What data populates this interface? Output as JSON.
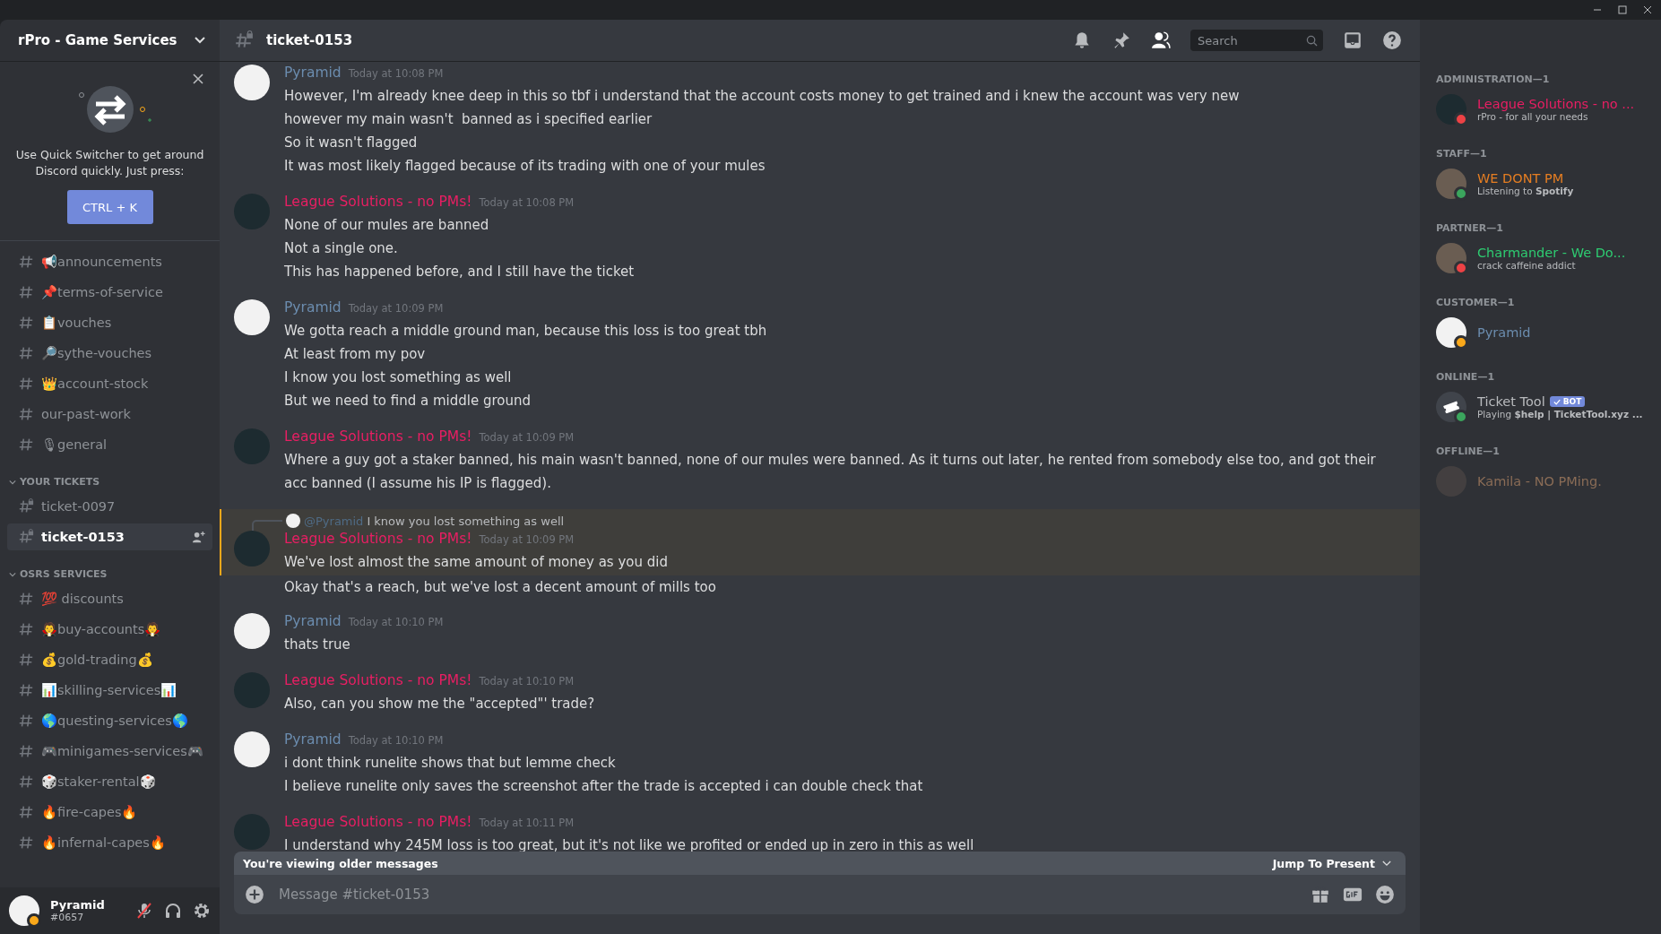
{
  "server": {
    "name": "rPro - Game Services"
  },
  "quick_switcher": {
    "text": "Use Quick Switcher to get around Discord quickly. Just press:",
    "button": "CTRL + K"
  },
  "channels": [
    {
      "name": "📢announcements",
      "kind": "text",
      "selected": false
    },
    {
      "name": "📌terms-of-service",
      "kind": "text",
      "selected": false
    },
    {
      "name": "📋vouches",
      "kind": "text",
      "selected": false
    },
    {
      "name": "🔎sythe-vouches",
      "kind": "text",
      "selected": false
    },
    {
      "name": "👑account-stock",
      "kind": "text",
      "selected": false
    },
    {
      "name": "our-past-work",
      "kind": "text",
      "selected": false
    },
    {
      "name": "🎙general",
      "kind": "text",
      "selected": false
    }
  ],
  "categories": [
    {
      "name": "YOUR TICKETS",
      "expanded": true,
      "channels": [
        {
          "name": "ticket-0097",
          "kind": "locked",
          "selected": false
        },
        {
          "name": "ticket-0153",
          "kind": "locked",
          "selected": true
        }
      ]
    },
    {
      "name": "OSRS SERVICES",
      "expanded": true,
      "channels": [
        {
          "name": "💯 discounts",
          "kind": "text",
          "selected": false
        },
        {
          "name": "🧛buy-accounts🧛",
          "kind": "text",
          "selected": false
        },
        {
          "name": "💰gold-trading💰",
          "kind": "text",
          "selected": false
        },
        {
          "name": "📊skilling-services📊",
          "kind": "text",
          "selected": false
        },
        {
          "name": "🌎questing-services🌎",
          "kind": "text",
          "selected": false
        },
        {
          "name": "🎮minigames-services🎮",
          "kind": "text",
          "selected": false
        },
        {
          "name": "🎲staker-rental🎲",
          "kind": "text",
          "selected": false
        },
        {
          "name": "🔥fire-capes🔥",
          "kind": "text",
          "selected": false
        },
        {
          "name": "🔥infernal-capes🔥",
          "kind": "text",
          "selected": false
        }
      ]
    }
  ],
  "user_panel": {
    "name": "Pyramid",
    "tag": "#0657",
    "idle": true
  },
  "header": {
    "channel": "ticket-0153",
    "search_placeholder": "Search"
  },
  "messages": [
    {
      "author": "Pyramid",
      "color": "#6b8cae",
      "kind": "pyramid",
      "time": "Today at 10:08 PM",
      "highlighted": false,
      "lines": [
        "However, I'm already knee deep in this so tbf i understand that the account costs money to get trained and i knew the account was very new",
        "however my main wasn't  banned as i specified earlier",
        "So it wasn't flagged",
        "It was most likely flagged because of its trading with one of your mules"
      ]
    },
    {
      "author": "League Solutions - no PMs!",
      "color": "#e91e63",
      "kind": "rpro",
      "time": "Today at 10:08 PM",
      "highlighted": false,
      "lines": [
        "None of our mules are banned",
        "Not a single one.",
        "This has happened before, and I still have the ticket"
      ]
    },
    {
      "author": "Pyramid",
      "color": "#6b8cae",
      "kind": "pyramid",
      "time": "Today at 10:09 PM",
      "highlighted": false,
      "lines": [
        "We gotta reach a middle ground man, because this loss is too great tbh",
        "At least from my pov",
        "I know you lost something as well",
        "But we need to find a middle ground"
      ]
    },
    {
      "author": "League Solutions - no PMs!",
      "color": "#e91e63",
      "kind": "rpro",
      "time": "Today at 10:09 PM",
      "highlighted": false,
      "lines": [
        "Where a guy got a staker banned, his main wasn't banned, none of our mules were banned. As it turns out later, he rented from somebody else too, and got their acc banned (I assume his IP is flagged)."
      ]
    },
    {
      "author": "League Solutions - no PMs!",
      "color": "#e91e63",
      "kind": "rpro",
      "time": "Today at 10:09 PM",
      "highlighted": true,
      "reply": {
        "author": "@Pyramid",
        "text": "I know you lost something as well"
      },
      "lines": [
        "We've lost almost the same amount of money as you did"
      ],
      "after": [
        "Okay that's a reach, but we've lost a decent amount of mills too"
      ]
    },
    {
      "author": "Pyramid",
      "color": "#6b8cae",
      "kind": "pyramid",
      "time": "Today at 10:10 PM",
      "highlighted": false,
      "lines": [
        "thats true"
      ]
    },
    {
      "author": "League Solutions - no PMs!",
      "color": "#e91e63",
      "kind": "rpro",
      "time": "Today at 10:10 PM",
      "highlighted": false,
      "lines": [
        "Also, can you show me the \"accepted\"' trade?"
      ]
    },
    {
      "author": "Pyramid",
      "color": "#6b8cae",
      "kind": "pyramid",
      "time": "Today at 10:10 PM",
      "highlighted": false,
      "lines": [
        "i dont think runelite shows that but lemme check",
        "I believe runelite only saves the screenshot after the trade is accepted i can double check that"
      ]
    },
    {
      "author": "League Solutions - no PMs!",
      "color": "#e91e63",
      "kind": "rpro",
      "time": "Today at 10:11 PM",
      "highlighted": false,
      "lines": [
        "I understand why 245M loss is too great, but it's not like we profited or ended up in zero in this as well"
      ]
    }
  ],
  "banner": {
    "text": "You're viewing older messages",
    "button": "Jump To Present"
  },
  "composer": {
    "placeholder": "Message #ticket-0153"
  },
  "member_groups": [
    {
      "title": "ADMINISTRATION—1",
      "members": [
        {
          "name": "League Solutions - no ...",
          "color": "#e91e63",
          "status_dot": {
            "color": "#ed4245"
          },
          "offline": false,
          "kind": "rpro",
          "activity": "rPro - for all your needs",
          "bot": false
        }
      ]
    },
    {
      "title": "STAFF—1",
      "members": [
        {
          "name": "WE DONT PM",
          "color": "#e67e22",
          "status_dot": {
            "color": "#3ba55d"
          },
          "offline": false,
          "kind": "photo",
          "activity": "Listening to **Spotify**",
          "bot": false
        }
      ]
    },
    {
      "title": "PARTNER—1",
      "members": [
        {
          "name": "Charmander - We Do...",
          "color": "#2ecc71",
          "status_dot": {
            "color": "#ed4245"
          },
          "offline": false,
          "kind": "photo",
          "activity": "crack caffeine addict",
          "bot": false
        }
      ]
    },
    {
      "title": "CUSTOMER—1",
      "members": [
        {
          "name": "Pyramid",
          "color": "#6b8cae",
          "status_dot": {
            "color": "#faa81a"
          },
          "offline": false,
          "kind": "pyramid",
          "bot": false
        }
      ]
    },
    {
      "title": "ONLINE—1",
      "members": [
        {
          "name": "Ticket Tool",
          "color": "#b9bbbe",
          "status_dot": {
            "color": "#3ba55d"
          },
          "offline": false,
          "kind": "ticket",
          "activity": "Playing **$help | TicketTool.xyz ...**",
          "bot": true,
          "bot_label": "BOT"
        }
      ]
    },
    {
      "title": "OFFLINE—1",
      "members": [
        {
          "name": "Kamila - NO PMing.",
          "color": "#8a6c56",
          "offline": true,
          "kind": "photo",
          "bot": false
        }
      ]
    }
  ]
}
